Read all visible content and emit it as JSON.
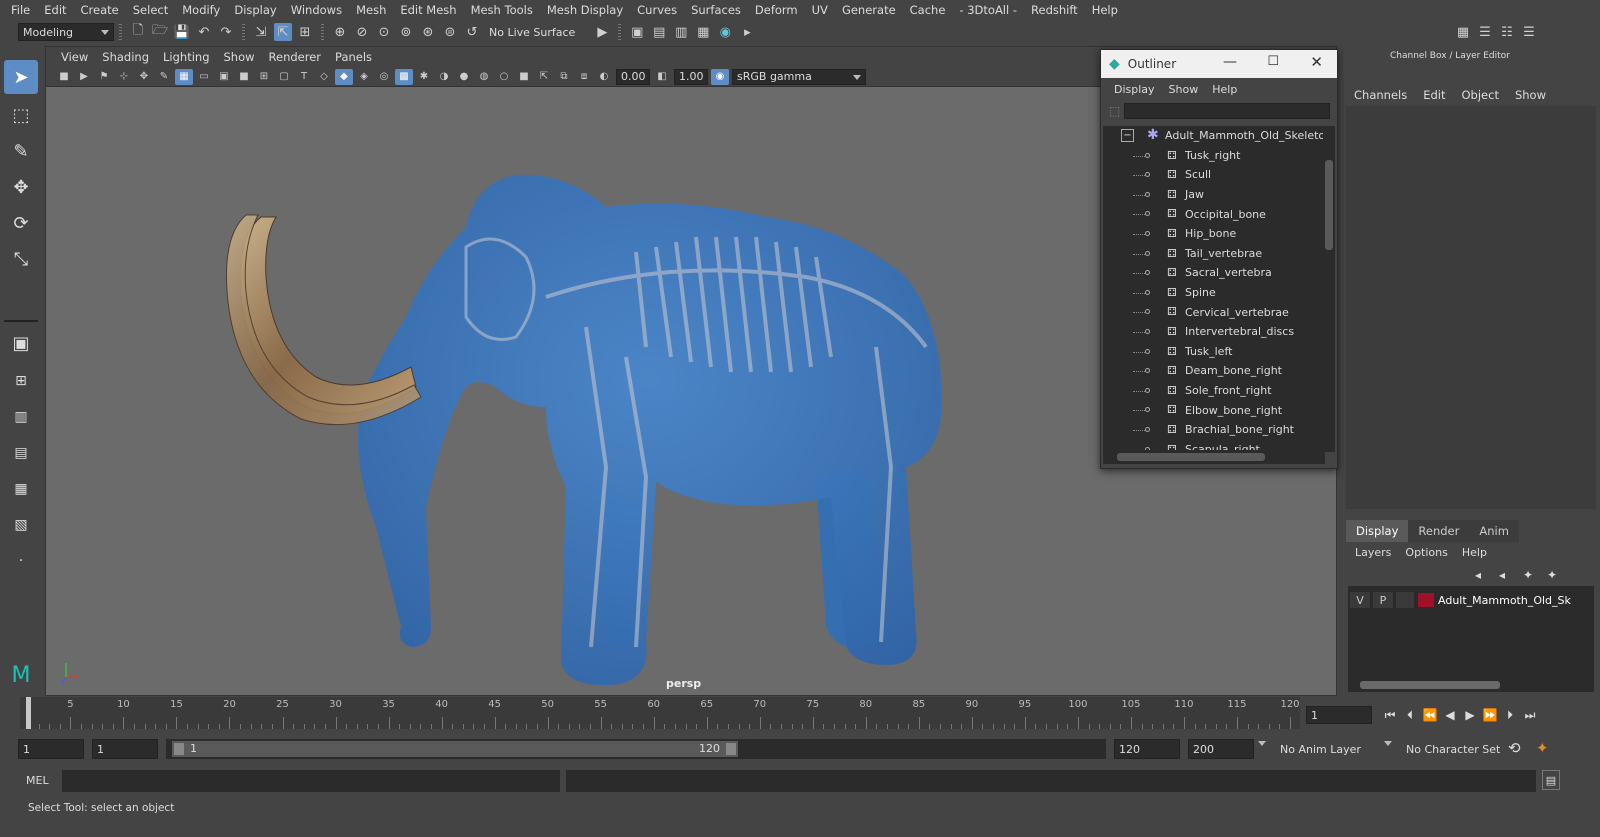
{
  "menubar": {
    "items": [
      "File",
      "Edit",
      "Create",
      "Select",
      "Modify",
      "Display",
      "Windows",
      "Mesh",
      "Edit Mesh",
      "Mesh Tools",
      "Mesh Display",
      "Curves",
      "Surfaces",
      "Deform",
      "UV",
      "Generate",
      "Cache",
      "- 3DtoAll -",
      "Redshift",
      "Help"
    ]
  },
  "shelf": {
    "mode_menu": "Modeling",
    "live_surface": "No Live Surface"
  },
  "viewport": {
    "menu": [
      "View",
      "Shading",
      "Lighting",
      "Show",
      "Renderer",
      "Panels"
    ],
    "exposure": "0.00",
    "gamma": "1.00",
    "color_space": "sRGB gamma",
    "camera_label": "persp"
  },
  "outliner": {
    "title": "Outliner",
    "menu": [
      "Display",
      "Show",
      "Help"
    ],
    "root": "Adult_Mammoth_Old_Skeleton_",
    "children": [
      "Tusk_right",
      "Scull",
      "Jaw",
      "Occipital_bone",
      "Hip_bone",
      "Tail_vertebrae",
      "Sacral_vertebra",
      "Spine",
      "Cervical_vertebrae",
      "Intervertebral_discs",
      "Tusk_left",
      "Deam_bone_right",
      "Sole_front_right",
      "Elbow_bone_right",
      "Brachial_bone_right",
      "Scapula_right"
    ]
  },
  "channelbox": {
    "title": "Channel Box / Layer Editor",
    "menu": [
      "Channels",
      "Edit",
      "Object",
      "Show"
    ],
    "tabs": [
      "Display",
      "Render",
      "Anim"
    ],
    "layer_menu": [
      "Layers",
      "Options",
      "Help"
    ],
    "layer": {
      "v": "V",
      "p": "P",
      "name": "Adult_Mammoth_Old_Sk",
      "color": "#a0102a"
    }
  },
  "timeline": {
    "ticks": [
      "1",
      "5",
      "10",
      "15",
      "20",
      "25",
      "30",
      "35",
      "40",
      "45",
      "50",
      "55",
      "60",
      "65",
      "70",
      "75",
      "80",
      "85",
      "90",
      "95",
      "100",
      "105",
      "110",
      "115",
      "120"
    ],
    "current_frame": "1"
  },
  "range": {
    "start": "1",
    "anim_start": "1",
    "slider_start": "1",
    "slider_end": "120",
    "anim_end": "120",
    "end": "200",
    "anim_layer": "No Anim Layer",
    "char_set": "No Character Set"
  },
  "cmd": {
    "lang": "MEL",
    "help": "Select Tool: select an object"
  },
  "colors": {
    "accent": "#5d8dc4",
    "mammoth": "#3f7cc4",
    "viewport_bg": "#6b6b6b"
  }
}
